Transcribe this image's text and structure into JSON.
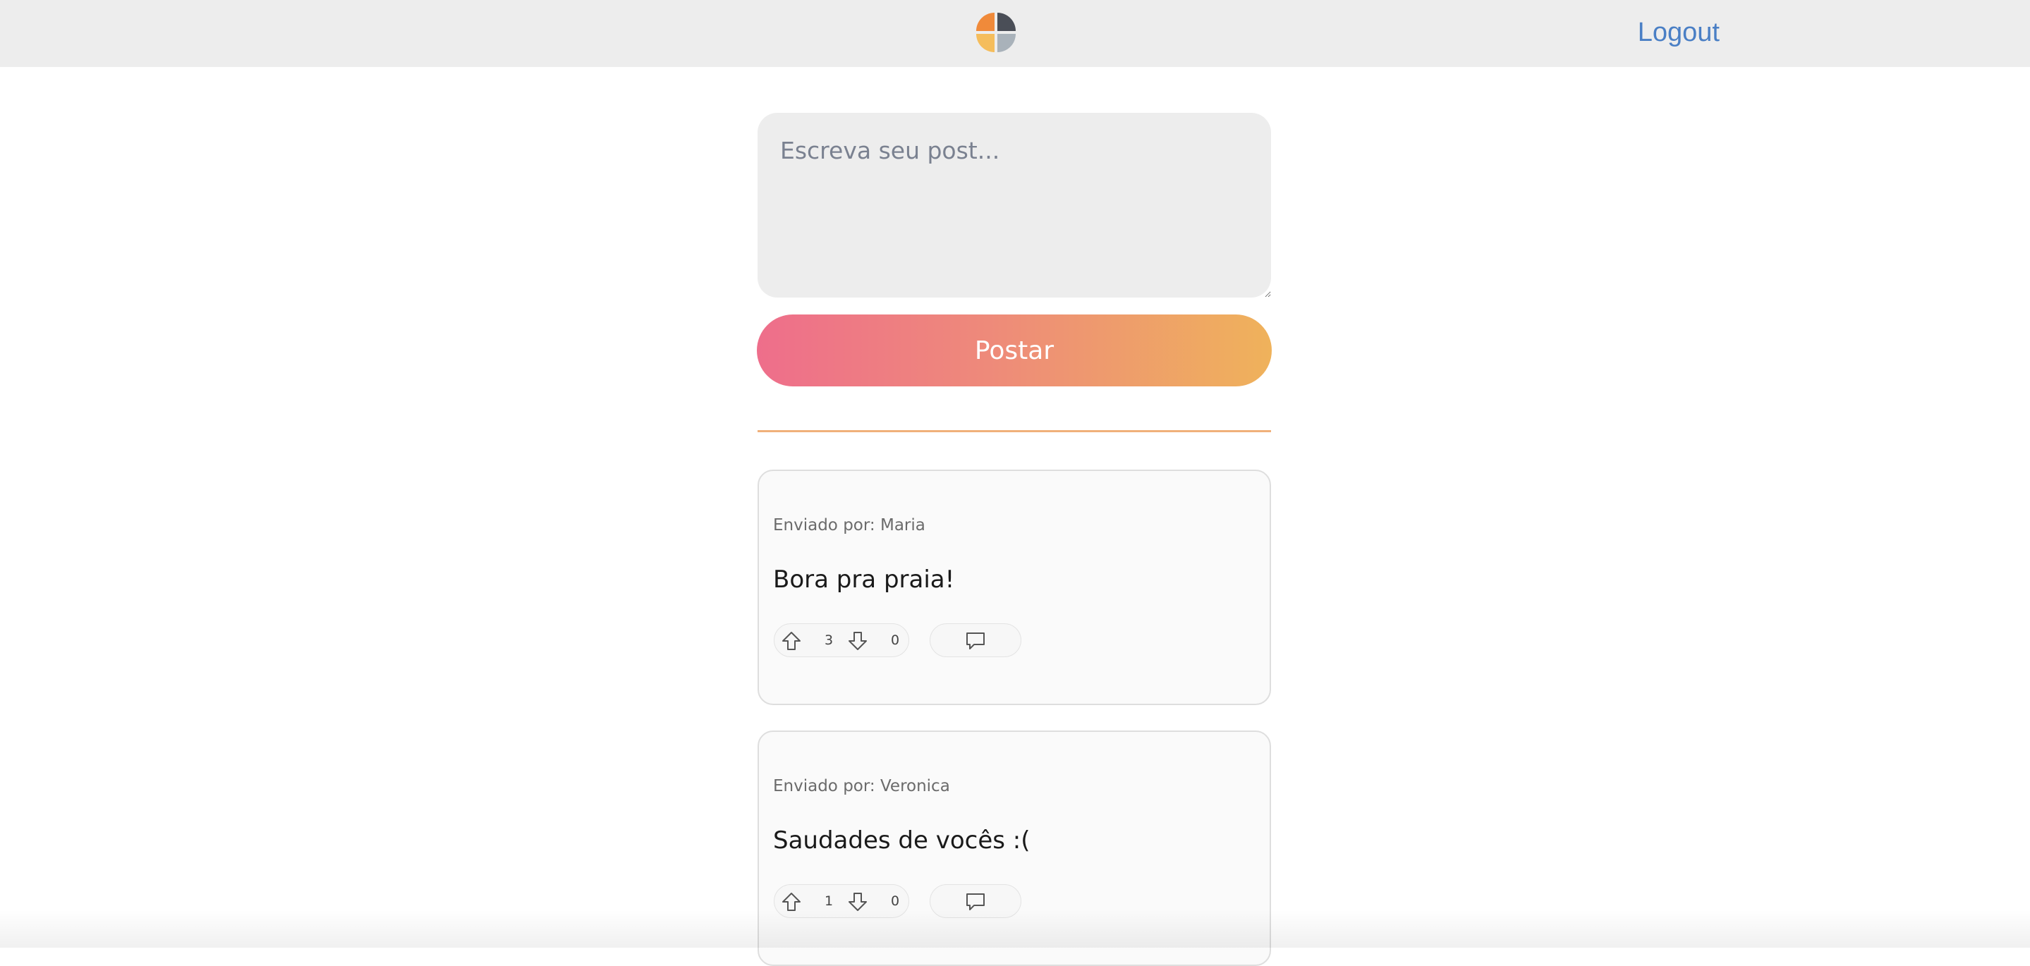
{
  "header": {
    "logo_icon": "brand-logo-icon",
    "logout_label": "Logout"
  },
  "composer": {
    "placeholder": "Escreva seu post...",
    "value": "",
    "submit_label": "Postar"
  },
  "colors": {
    "accent_gradient_start": "#ee6e8b",
    "accent_gradient_end": "#efb25b",
    "link": "#4a7fc5",
    "divider": "#f0b07a"
  },
  "posts": [
    {
      "author": "Enviado por: Maria",
      "text": "Bora pra praia!",
      "upvotes": "3",
      "downvotes": "0",
      "upvote_icon": "arrow-up-icon",
      "downvote_icon": "arrow-down-icon",
      "comment_icon": "comment-icon"
    },
    {
      "author": "Enviado por: Veronica",
      "text": "Saudades de vocês :(",
      "upvotes": "1",
      "downvotes": "0",
      "upvote_icon": "arrow-up-icon",
      "downvote_icon": "arrow-down-icon",
      "comment_icon": "comment-icon"
    }
  ]
}
